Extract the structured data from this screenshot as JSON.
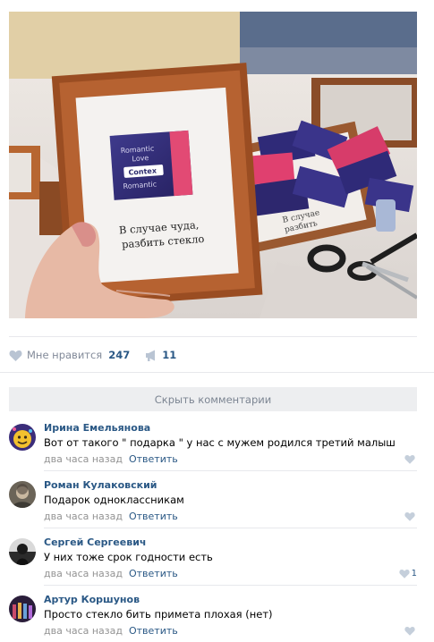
{
  "photo": {
    "frame_caption_line1": "В случае чуда,",
    "frame_caption_line2": "разбить стекло",
    "package_brand": "Contex",
    "package_line1": "Romantic",
    "package_line2": "Love",
    "back_frame_caption_line1": "В случае",
    "back_frame_caption_line2": "разбить"
  },
  "post_actions": {
    "like_label": "Мне нравится",
    "like_count": "247",
    "share_count": "11"
  },
  "hide_comments_label": "Скрыть комментарии",
  "comments": [
    {
      "author": "Ирина Емельянова",
      "text": "Вот от такого \" подарка \" у нас с мужем родился третий малыш",
      "time": "два часа назад",
      "reply_label": "Ответить",
      "likes": ""
    },
    {
      "author": "Роман Кулаковский",
      "text": "Подарок одноклассникам",
      "time": "два часа назад",
      "reply_label": "Ответить",
      "likes": ""
    },
    {
      "author": "Сергей Сергеевич",
      "text": "У них тоже срок годности есть",
      "time": "два часа назад",
      "reply_label": "Ответить",
      "likes": "1"
    },
    {
      "author": "Артур Коршунов",
      "text": "Просто стекло бить примета плохая (нет)",
      "time": "два часа назад",
      "reply_label": "Ответить",
      "likes": ""
    }
  ],
  "colors": {
    "link": "#2a5885",
    "meta_gray": "#939393",
    "hide_bar_bg": "#edeef0",
    "divider": "#e7e8ec"
  }
}
